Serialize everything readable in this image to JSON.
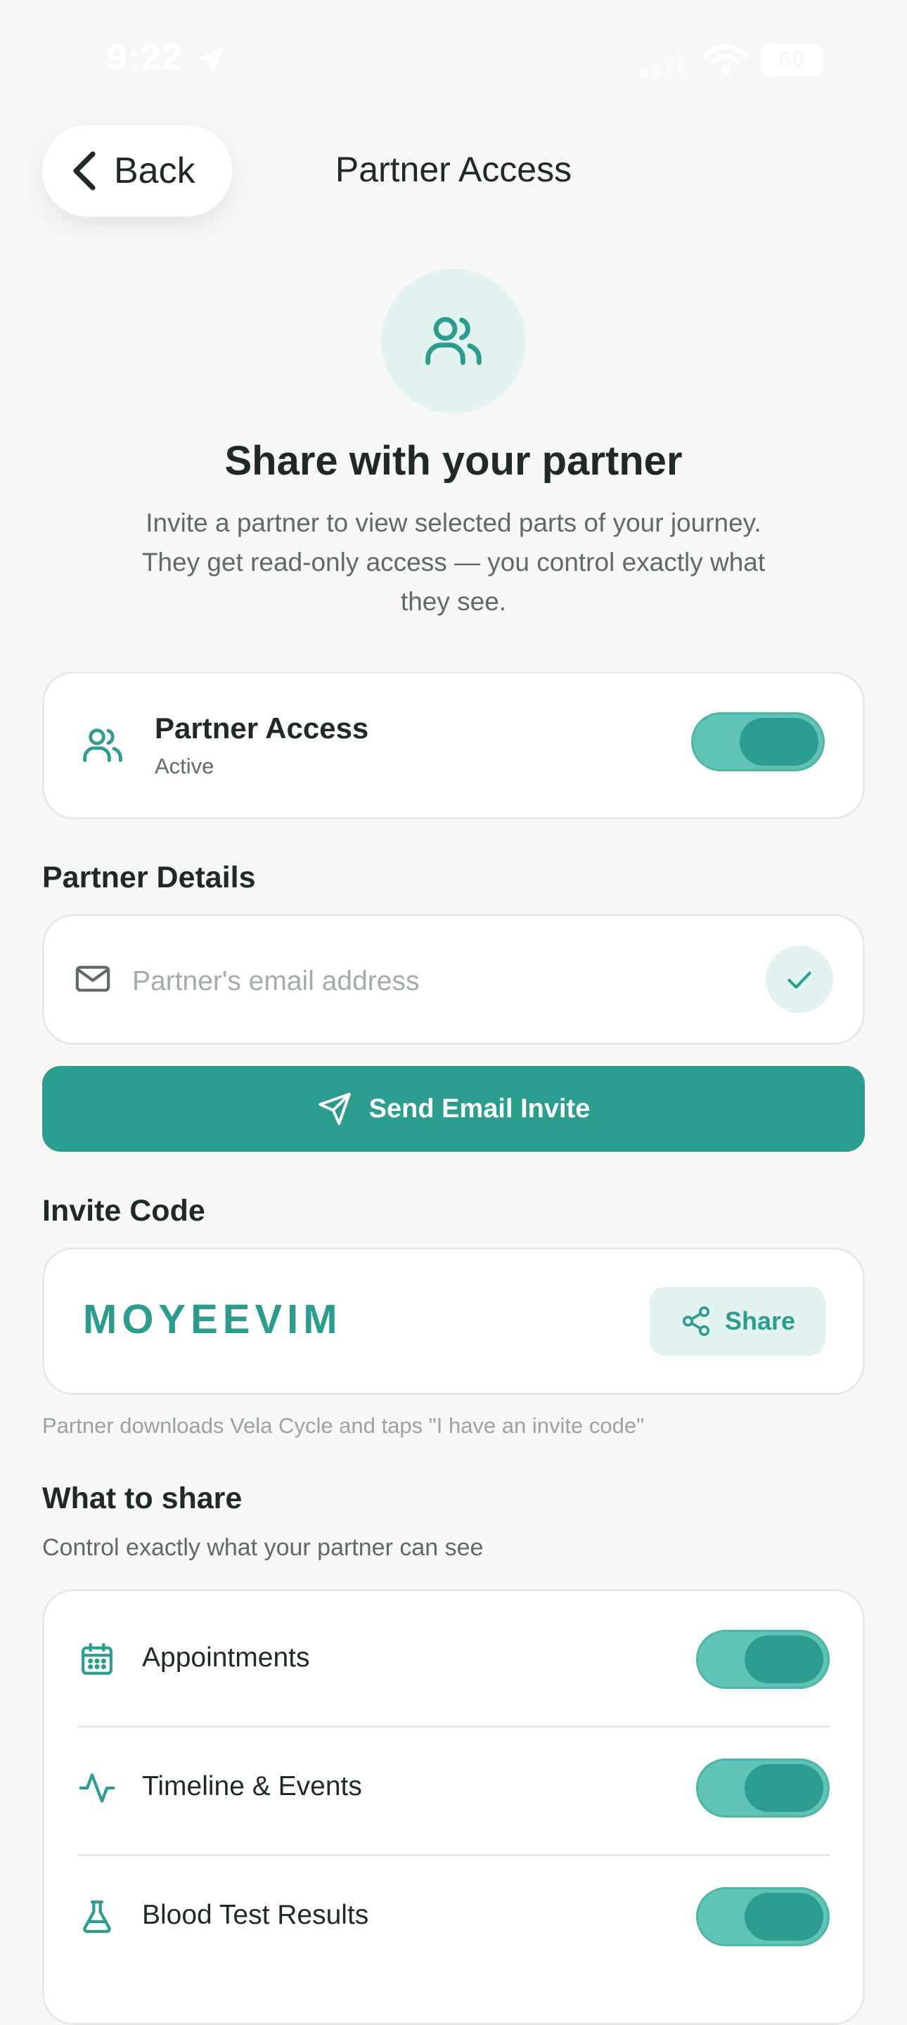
{
  "status_bar": {
    "time": "9:22",
    "battery": "60"
  },
  "header": {
    "back_label": "Back",
    "title": "Partner Access"
  },
  "hero": {
    "title": "Share with your partner",
    "subtitle": "Invite a partner to view selected parts of your journey. They get read-only access — you control exactly what they see."
  },
  "access": {
    "title": "Partner Access",
    "status": "Active",
    "enabled": true
  },
  "partner_details": {
    "label": "Partner Details",
    "email_placeholder": "Partner's email address",
    "email_value": "",
    "send_label": "Send Email Invite"
  },
  "invite_code": {
    "label": "Invite Code",
    "code": "MOYEEVIM",
    "share_label": "Share",
    "hint": "Partner downloads Vela Cycle and taps \"I have an invite code\""
  },
  "what_to_share": {
    "title": "What to share",
    "subtitle": "Control exactly what your partner can see",
    "items": [
      {
        "label": "Appointments",
        "icon": "calendar-icon",
        "enabled": true
      },
      {
        "label": "Timeline & Events",
        "icon": "activity-icon",
        "enabled": true
      },
      {
        "label": "Blood Test Results",
        "icon": "flask-icon",
        "enabled": true
      }
    ]
  },
  "colors": {
    "accent": "#2a9d8f",
    "accent_light": "#e3f3f1",
    "toggle_track": "#5fc4b5",
    "background": "#f7f7f5"
  }
}
